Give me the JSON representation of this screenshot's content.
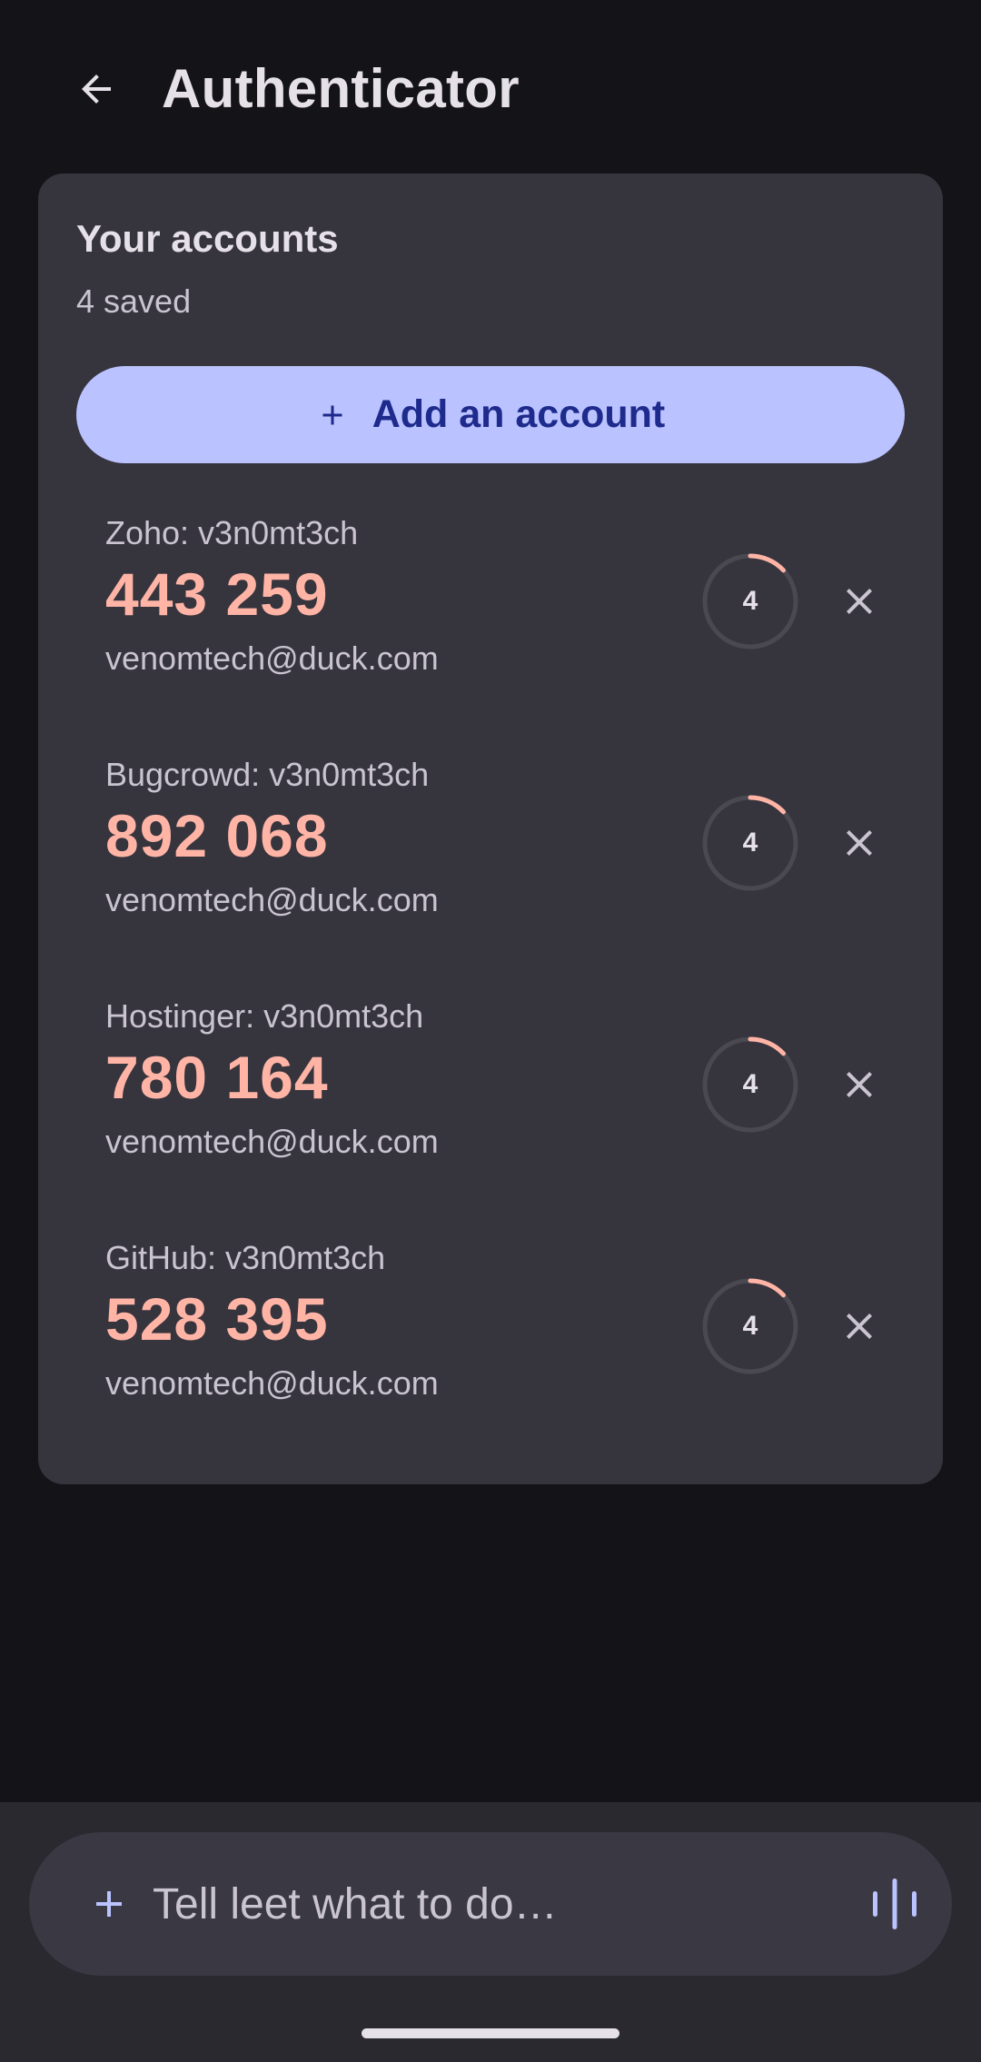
{
  "app_bar": {
    "title": "Authenticator",
    "back_icon": "arrow-left-icon"
  },
  "accounts_card": {
    "title": "Your accounts",
    "subtitle": "4 saved",
    "add_button_label": "Add an account",
    "add_icon": "plus-icon"
  },
  "accounts": [
    {
      "issuer": "Zoho: v3n0mt3ch",
      "code": "443 259",
      "email": "venomtech@duck.com",
      "seconds_left": "4",
      "progress": 0.13
    },
    {
      "issuer": "Bugcrowd: v3n0mt3ch",
      "code": "892 068",
      "email": "venomtech@duck.com",
      "seconds_left": "4",
      "progress": 0.13
    },
    {
      "issuer": "Hostinger: v3n0mt3ch",
      "code": "780 164",
      "email": "venomtech@duck.com",
      "seconds_left": "4",
      "progress": 0.13
    },
    {
      "issuer": "GitHub: v3n0mt3ch",
      "code": "528 395",
      "email": "venomtech@duck.com",
      "seconds_left": "4",
      "progress": 0.13
    }
  ],
  "composer": {
    "placeholder": "Tell leet what to do…",
    "attach_icon": "plus-icon",
    "voice_icon": "voice-waveform-icon"
  },
  "colors": {
    "background": "#141318",
    "card": "#36343D",
    "accent_button": "#BAC3FF",
    "code": "#FFB4A6",
    "timer_track": "#4A4851"
  }
}
